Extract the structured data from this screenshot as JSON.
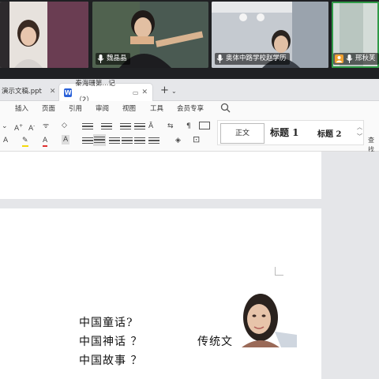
{
  "meeting": {
    "participants": [
      {
        "name": ""
      },
      {
        "name": "魏晶晶"
      },
      {
        "name": "奥体中路学校赵学历"
      },
      {
        "name": "邢秋芙"
      }
    ]
  },
  "tabs": [
    {
      "title": "演示文稿.ppt"
    },
    {
      "title": "秦海珊第...记（2）"
    }
  ],
  "menu": [
    "插入",
    "页面",
    "引用",
    "审阅",
    "视图",
    "工具",
    "会员专享"
  ],
  "styles": {
    "normal": "正文",
    "h1": "标题 1",
    "h2": "标题 2"
  },
  "toolbar": {
    "find_label": "查找"
  },
  "document": {
    "lines": [
      "中国童话?",
      "中国神话 ？",
      "中国故事 ？"
    ],
    "side_text": "传统文"
  },
  "colors": {
    "accent": "#2b62d9",
    "active_speaker": "#2f9a47"
  }
}
